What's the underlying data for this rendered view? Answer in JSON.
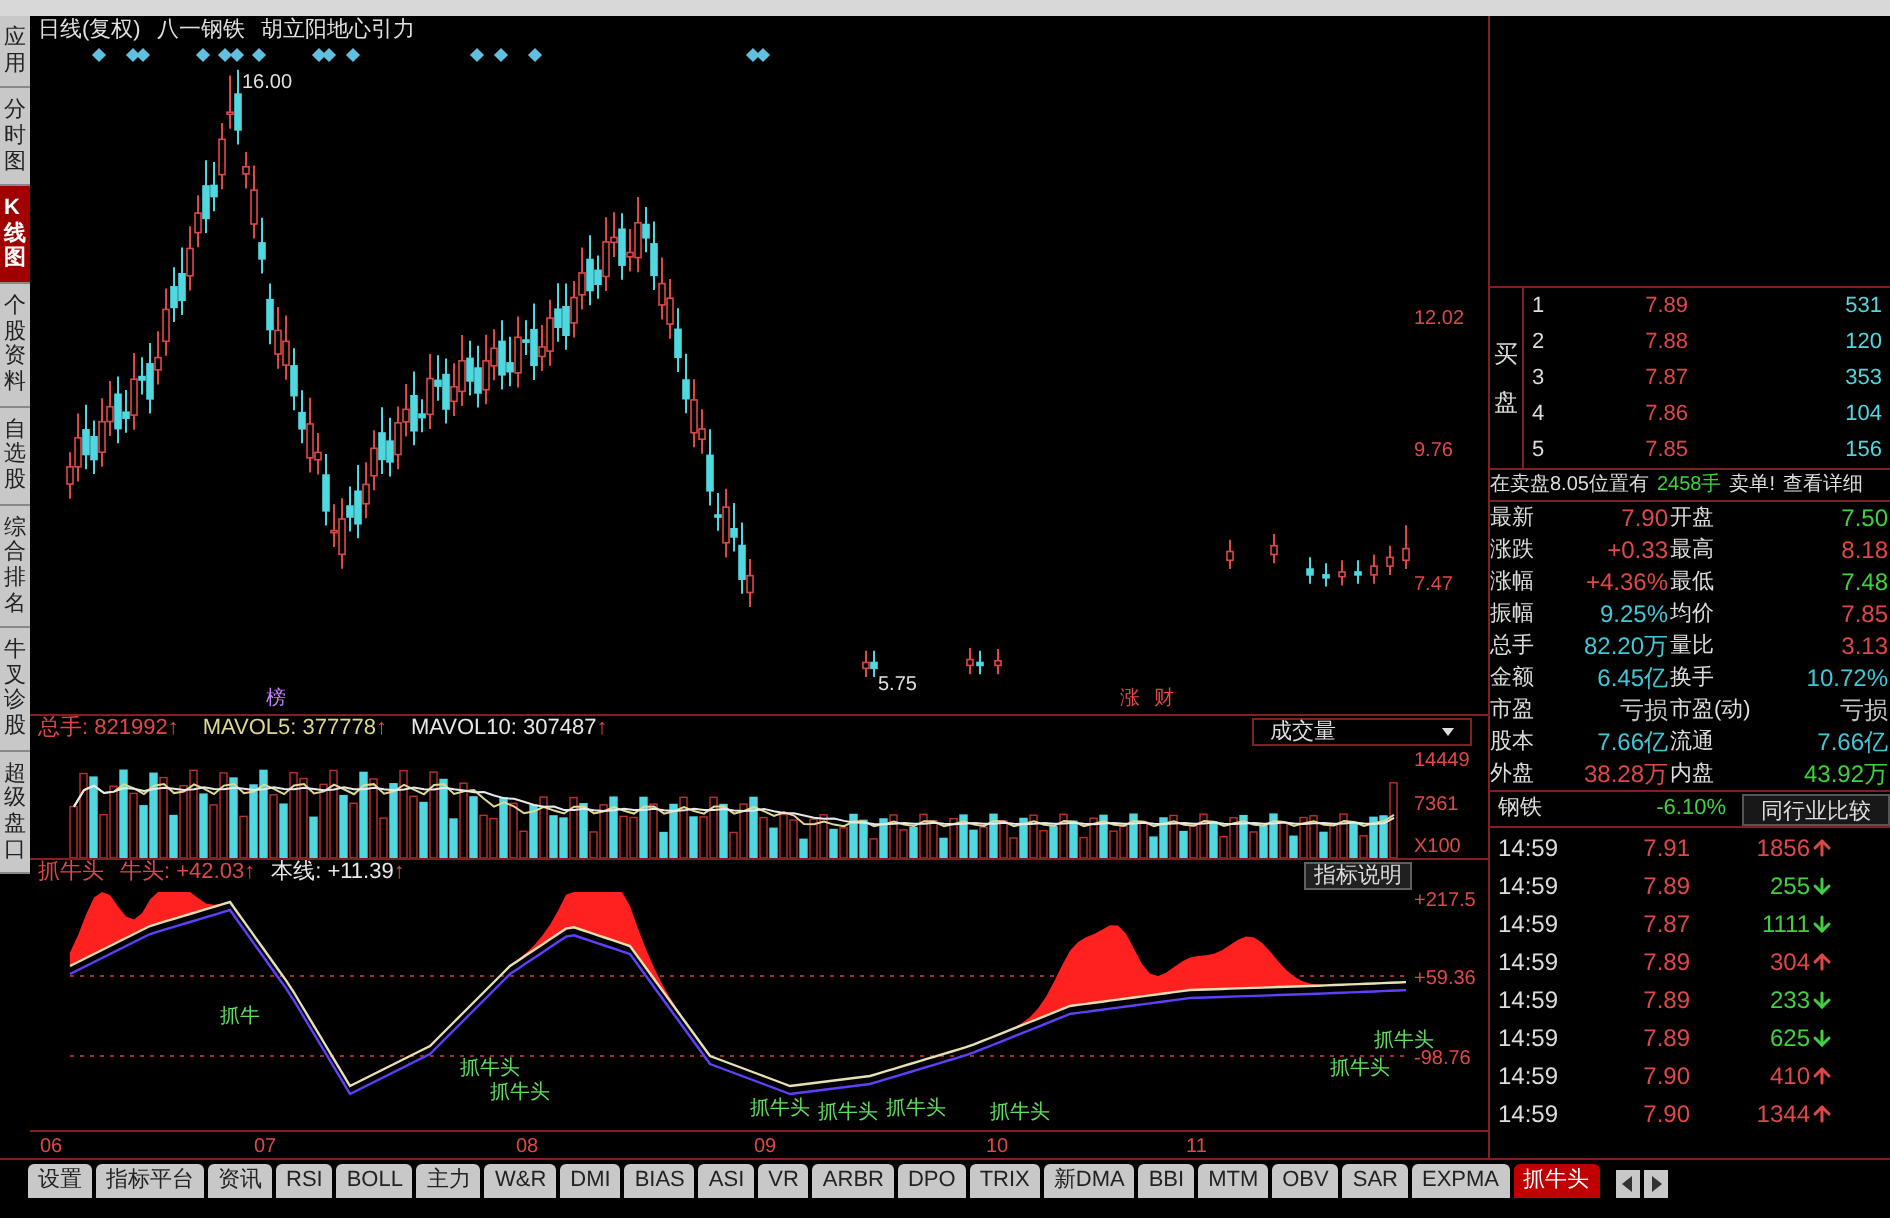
{
  "header": {
    "period": "日线(复权)",
    "stock": "八一钢铁",
    "indicator": "胡立阳地心引力"
  },
  "sidebar": [
    {
      "label": "应用",
      "selected": false
    },
    {
      "label": "分时图",
      "selected": false
    },
    {
      "label": "K线图",
      "selected": true
    },
    {
      "label": "个股资料",
      "selected": false
    },
    {
      "label": "自选股",
      "selected": false
    },
    {
      "label": "综合排名",
      "selected": false
    },
    {
      "label": "牛叉诊股",
      "selected": false
    },
    {
      "label": "超级盘口",
      "selected": false
    }
  ],
  "price_chart": {
    "axis_labels": [
      "12.02",
      "9.76",
      "7.47"
    ],
    "high_label": "16.00",
    "low_label": "5.75",
    "markers": [
      {
        "text": "榜",
        "color": "#c080ff"
      },
      {
        "text": "涨",
        "color": "#e04848"
      },
      {
        "text": "财",
        "color": "#e04848"
      }
    ]
  },
  "volume": {
    "items": [
      {
        "text": "总手: 821992",
        "arrow": "↑",
        "color": "#e04848"
      },
      {
        "text": "MAVOL5: 377778",
        "arrow": "↑",
        "color": "#e0d890"
      },
      {
        "text": "MAVOL10: 307487",
        "arrow": "↑",
        "color": "#e8e8e8"
      }
    ],
    "dropdown": "成交量",
    "axis_labels": [
      "14449",
      "7361",
      "X100"
    ]
  },
  "indicator": {
    "items": [
      {
        "text": "抓牛头",
        "color": "#e04848"
      },
      {
        "text": "牛头: +42.03",
        "arrow": "↑",
        "color": "#e04848"
      },
      {
        "text": "本线: +11.39",
        "arrow": "↑",
        "color": "#e8e8e8"
      }
    ],
    "button": "指标说明",
    "axis_labels": [
      "+217.5",
      "+59.36",
      "-98.76"
    ],
    "signals": [
      "抓牛",
      "抓牛头",
      "抓牛头",
      "抓牛头",
      "抓牛头",
      "抓牛头",
      "抓牛头",
      "抓牛头",
      "抓牛头"
    ]
  },
  "x_axis": [
    "06",
    "07",
    "08",
    "09",
    "10",
    "11"
  ],
  "tabs": [
    {
      "label": "设置",
      "selected": false
    },
    {
      "label": "指标平台",
      "selected": false
    },
    {
      "label": "资讯",
      "selected": false
    },
    {
      "label": "RSI",
      "selected": false
    },
    {
      "label": "BOLL",
      "selected": false
    },
    {
      "label": "主力",
      "selected": false
    },
    {
      "label": "W&R",
      "selected": false
    },
    {
      "label": "DMI",
      "selected": false
    },
    {
      "label": "BIAS",
      "selected": false
    },
    {
      "label": "ASI",
      "selected": false
    },
    {
      "label": "VR",
      "selected": false
    },
    {
      "label": "ARBR",
      "selected": false
    },
    {
      "label": "DPO",
      "selected": false
    },
    {
      "label": "TRIX",
      "selected": false
    },
    {
      "label": "新DMA",
      "selected": false
    },
    {
      "label": "BBI",
      "selected": false
    },
    {
      "label": "MTM",
      "selected": false
    },
    {
      "label": "OBV",
      "selected": false
    },
    {
      "label": "SAR",
      "selected": false
    },
    {
      "label": "EXPMA",
      "selected": false
    },
    {
      "label": "抓牛头",
      "selected": true
    }
  ],
  "order_book": {
    "side_label": "买盘",
    "rows": [
      {
        "rank": "1",
        "price": "7.89",
        "volume": "531"
      },
      {
        "rank": "2",
        "price": "7.88",
        "volume": "120"
      },
      {
        "rank": "3",
        "price": "7.87",
        "volume": "353"
      },
      {
        "rank": "4",
        "price": "7.86",
        "volume": "104"
      },
      {
        "rank": "5",
        "price": "7.85",
        "volume": "156"
      }
    ]
  },
  "notice": {
    "text": "在卖盘8.05位置有",
    "amount": "2458手",
    "alert": "卖单!",
    "link": "查看详细"
  },
  "stats": [
    {
      "label": "最新",
      "value": "7.90",
      "color": "#e04848"
    },
    {
      "label": "开盘",
      "value": "7.50",
      "color": "#40d040"
    },
    {
      "label": "涨跌",
      "value": "+0.33",
      "color": "#e04848"
    },
    {
      "label": "最高",
      "value": "8.18",
      "color": "#e04848"
    },
    {
      "label": "涨幅",
      "value": "+4.36%",
      "color": "#e04848"
    },
    {
      "label": "最低",
      "value": "7.48",
      "color": "#40d040"
    },
    {
      "label": "振幅",
      "value": "9.25%",
      "color": "#40c8d8"
    },
    {
      "label": "均价",
      "value": "7.85",
      "color": "#e04848"
    },
    {
      "label": "总手",
      "value": "82.20万",
      "color": "#40c8d8"
    },
    {
      "label": "量比",
      "value": "3.13",
      "color": "#e04848"
    },
    {
      "label": "金额",
      "value": "6.45亿",
      "color": "#40c8d8"
    },
    {
      "label": "换手",
      "value": "10.72%",
      "color": "#40c8d8"
    },
    {
      "label": "市盈",
      "value": "亏损",
      "color": "#c0c0c0"
    },
    {
      "label": "市盈(动)",
      "value": "亏损",
      "color": "#c0c0c0"
    },
    {
      "label": "股本",
      "value": "7.66亿",
      "color": "#40c8d8"
    },
    {
      "label": "流通",
      "value": "7.66亿",
      "color": "#40c8d8"
    },
    {
      "label": "外盘",
      "value": "38.28万",
      "color": "#e04848"
    },
    {
      "label": "内盘",
      "value": "43.92万",
      "color": "#40d040"
    }
  ],
  "sector": {
    "name": "钢铁",
    "change": "-6.10%",
    "button": "同行业比较"
  },
  "trades": [
    {
      "time": "14:59",
      "price": "7.91",
      "volume": "1856",
      "up": true
    },
    {
      "time": "14:59",
      "price": "7.89",
      "volume": "255",
      "up": false
    },
    {
      "time": "14:59",
      "price": "7.87",
      "volume": "1111",
      "up": false
    },
    {
      "time": "14:59",
      "price": "7.89",
      "volume": "304",
      "up": true
    },
    {
      "time": "14:59",
      "price": "7.89",
      "volume": "233",
      "up": false
    },
    {
      "time": "14:59",
      "price": "7.89",
      "volume": "625",
      "up": false
    },
    {
      "time": "14:59",
      "price": "7.90",
      "volume": "410",
      "up": true
    },
    {
      "time": "14:59",
      "price": "7.90",
      "volume": "1344",
      "up": true
    }
  ]
}
